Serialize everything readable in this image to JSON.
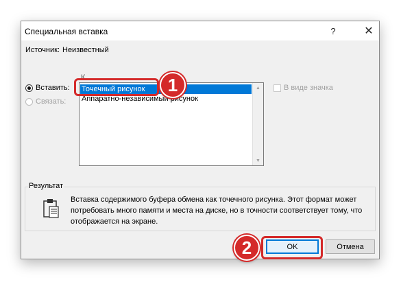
{
  "dialog": {
    "title": "Специальная вставка",
    "help_label": "?",
    "close_label": "✕",
    "source_label": "Источник:",
    "source_value": "Неизвестный",
    "as_label": "К",
    "paste_label": "Вставить:",
    "link_label": "Связать:",
    "list_items": [
      "Точечный рисунок",
      "Аппаратно-независимый рисунок"
    ],
    "display_as_icon_label": "В виде значка",
    "result_group_label": "Результат",
    "result_text": "Вставка содержимого буфера обмена как точечного рисунка. Этот формат может потребовать много памяти и места на диске, но в точности соответствует тому, что отображается на экране.",
    "ok_label": "OK",
    "cancel_label": "Отмена"
  },
  "annotations": {
    "badge_1": "1",
    "badge_2": "2",
    "highlight_color": "#d42a2a"
  },
  "icons": {
    "clipboard": "clipboard-icon",
    "close": "close-icon",
    "help": "help-icon"
  },
  "colors": {
    "selection": "#0078d7",
    "dialog_bg": "#f0f0f0"
  }
}
